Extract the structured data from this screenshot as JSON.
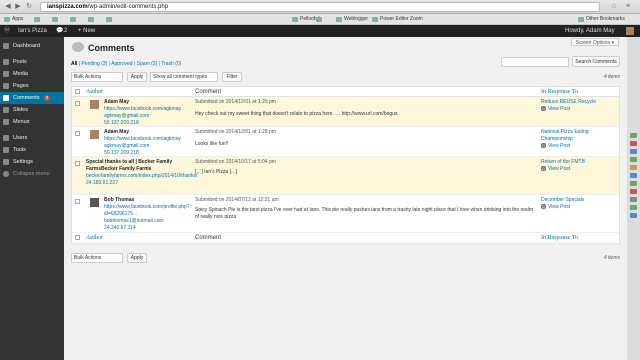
{
  "browser": {
    "url_host": "ianspizza.com",
    "url_path": "/wp-admin/edit-comments.php",
    "bookmarks": [
      "Apps",
      "",
      "",
      "",
      "",
      "",
      "Pelloob.it",
      "",
      "Weblogger",
      "Power Editor Zoom",
      "Other Bookmarks"
    ]
  },
  "adminbar": {
    "site": "Ian's Pizza",
    "comments_count": "2",
    "new_label": "+ New",
    "howdy": "Howdy, Adam May"
  },
  "sidebar": {
    "items": [
      {
        "label": "Dashboard",
        "count": ""
      },
      {
        "label": "Posts",
        "count": ""
      },
      {
        "label": "Media",
        "count": ""
      },
      {
        "label": "Pages",
        "count": ""
      },
      {
        "label": "Comments",
        "count": "3"
      },
      {
        "label": "Slides",
        "count": ""
      },
      {
        "label": "Menus",
        "count": ""
      },
      {
        "label": "Users",
        "count": ""
      },
      {
        "label": "Tools",
        "count": ""
      },
      {
        "label": "Settings",
        "count": ""
      },
      {
        "label": "Collapse menu",
        "count": ""
      }
    ]
  },
  "page": {
    "title": "Comments",
    "screen_options": "Screen Options ▾"
  },
  "filters": {
    "all": "All",
    "pending": "Pending (3)",
    "approved": "Approved",
    "spam": "Spam (3)",
    "trash": "Trash (0)",
    "sep": "|"
  },
  "search": {
    "button": "Search Comments",
    "placeholder": ""
  },
  "toolbar": {
    "bulk": "Bulk Actions",
    "apply": "Apply",
    "types": "Show all comment types",
    "filter": "Filter",
    "items": "4 items"
  },
  "columns": {
    "author": "Author",
    "comment": "Comment",
    "response": "In Response To"
  },
  "rows": [
    {
      "name": "Adam May",
      "url": "https://www.facebook.com/agkmay",
      "email": "agkmay@gmail.com",
      "ip": "50.137.209.218",
      "submitted": "Submitted on 2014/12/01 at 1:29 pm",
      "text": "Hey check out my sweet thing that doesn't relate to pizza here …. http://www.url.com/bogus",
      "post": "Reduce REUSE Recycle",
      "view": "View Post"
    },
    {
      "name": "Adam May",
      "url": "https://www.facebook.com/agkmay",
      "email": "agkmay@gmail.com",
      "ip": "50.137.209.218",
      "submitted": "Submitted on 2014/12/01 at 1:28 pm",
      "text": "Looks like fun!!",
      "post": "National Pizza Eating Championship",
      "view": "View Post"
    },
    {
      "name": "Special thanks to all | Becker Family FarmsBecker Family Farms",
      "url": "beckerfamilyfarms.com/index.php/2014/10/thanks/",
      "email": "",
      "ip": "24.183.61.227",
      "submitted": "Submitted on 2014/10/17 at 5:04 pm",
      "text": "[…] Ian's Pizza […]",
      "post": "Return of the FMTB",
      "view": "View Post"
    },
    {
      "name": "Bob Thomas",
      "url": "https://www.facebook.com/profile.php?id=68296175...",
      "email": "bobthomas1@hotmail.com",
      "ip": "24.240.67.114",
      "submitted": "Submitted on 2014/07/12 at 12:31 am",
      "text": "Spicy Spinach Pie is the best pizza I've ever had at Ians. This pie really pushes ians from a trashy late night place that I love when drinking into the realm of really nice pizza",
      "post": "December Specials",
      "view": "View Post"
    }
  ],
  "colors": {
    "accent": "#0074a2",
    "pending_bg": "#fef7db",
    "sidebar_bg": "#333333",
    "adminbar_bg": "#222222"
  }
}
